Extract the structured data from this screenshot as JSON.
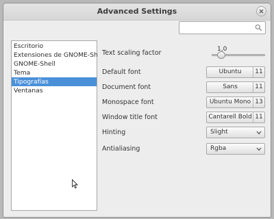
{
  "window": {
    "title": "Advanced Settings"
  },
  "search": {
    "value": "",
    "placeholder": ""
  },
  "sidebar": {
    "items": [
      {
        "label": "Escritorio",
        "selected": false
      },
      {
        "label": "Extensiones de GNOME-Shell",
        "selected": false
      },
      {
        "label": "GNOME-Shell",
        "selected": false
      },
      {
        "label": "Tema",
        "selected": false
      },
      {
        "label": "Tipografías",
        "selected": true
      },
      {
        "label": "Ventanas",
        "selected": false
      }
    ]
  },
  "settings": {
    "text_scaling": {
      "label": "Text scaling factor",
      "value": "1,0"
    },
    "default_font": {
      "label": "Default font",
      "font": "Ubuntu",
      "size": "11"
    },
    "document_font": {
      "label": "Document font",
      "font": "Sans",
      "size": "11"
    },
    "monospace_font": {
      "label": "Monospace font",
      "font": "Ubuntu Mono",
      "size": "13"
    },
    "window_title_font": {
      "label": "Window title font",
      "font": "Cantarell Bold",
      "size": "11"
    },
    "hinting": {
      "label": "Hinting",
      "value": "Slight"
    },
    "antialiasing": {
      "label": "Antialiasing",
      "value": "Rgba"
    }
  },
  "colors": {
    "selection": "#4a90d9",
    "window_bg": "#ededed"
  },
  "icons": {
    "close": "close-icon",
    "search": "search-icon",
    "dropdown": "chevron-down-icon",
    "cursor": "mouse-pointer-icon"
  }
}
